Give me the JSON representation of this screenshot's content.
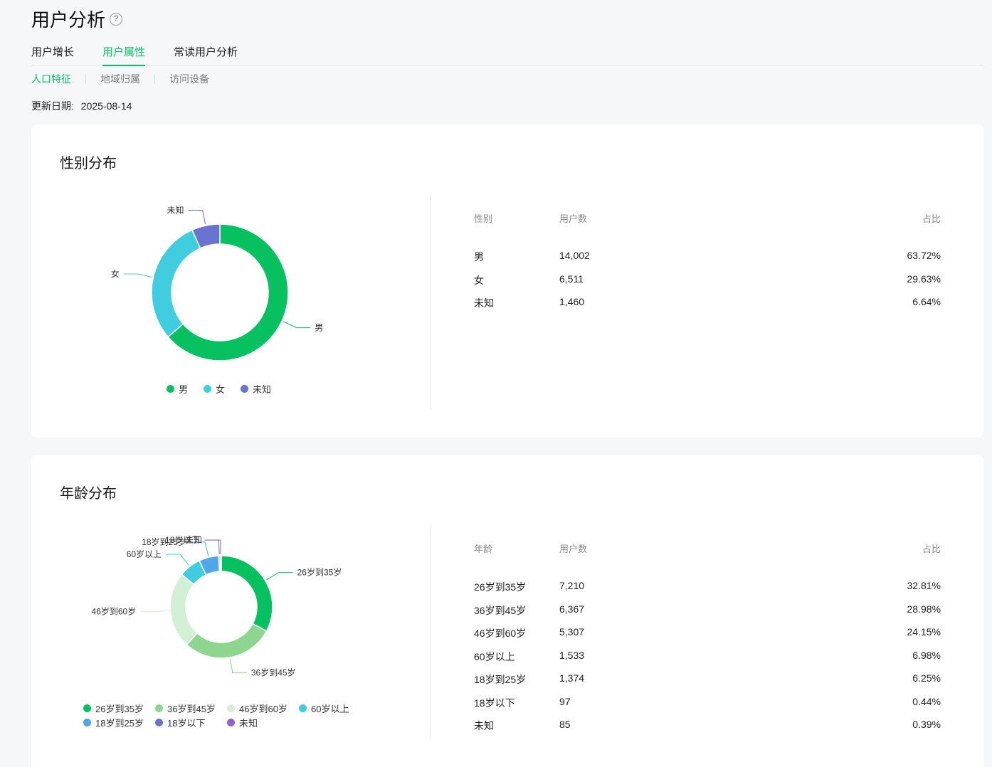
{
  "header": {
    "title": "用户分析",
    "help_icon": "question-circle-icon"
  },
  "tabs": [
    {
      "label": "用户增长"
    },
    {
      "label": "用户属性",
      "active": true
    },
    {
      "label": "常读用户分析"
    }
  ],
  "subtabs": [
    {
      "label": "人口特征",
      "active": true
    },
    {
      "label": "地域归属"
    },
    {
      "label": "访问设备"
    }
  ],
  "update": {
    "label": "更新日期:",
    "date": "2025-08-14"
  },
  "colors": {
    "accent": "#07c160"
  },
  "gender": {
    "title": "性别分布",
    "columns": {
      "name": "性别",
      "users": "用户数",
      "pct": "占比"
    },
    "rows": [
      {
        "name": "男",
        "users": "14,002",
        "pct": "63.72%",
        "color": "#07c160"
      },
      {
        "name": "女",
        "users": "6,511",
        "pct": "29.63%",
        "color": "#40cde0"
      },
      {
        "name": "未知",
        "users": "1,460",
        "pct": "6.64%",
        "color": "#6b73d1"
      }
    ]
  },
  "age": {
    "title": "年龄分布",
    "columns": {
      "name": "年龄",
      "users": "用户数",
      "pct": "占比"
    },
    "rows": [
      {
        "name": "26岁到35岁",
        "users": "7,210",
        "pct": "32.81%",
        "color": "#07c160"
      },
      {
        "name": "36岁到45岁",
        "users": "6,367",
        "pct": "28.98%",
        "color": "#8ed68f"
      },
      {
        "name": "46岁到60岁",
        "users": "5,307",
        "pct": "24.15%",
        "color": "#d2f0d5"
      },
      {
        "name": "60岁以上",
        "users": "1,533",
        "pct": "6.98%",
        "color": "#40cde0"
      },
      {
        "name": "18岁到25岁",
        "users": "1,374",
        "pct": "6.25%",
        "color": "#4fa7ea"
      },
      {
        "name": "18岁以下",
        "users": "97",
        "pct": "0.44%",
        "color": "#6b73d1"
      },
      {
        "name": "未知",
        "users": "85",
        "pct": "0.39%",
        "color": "#8f62d6"
      }
    ]
  },
  "chart_data": [
    {
      "type": "pie",
      "title": "性别分布",
      "categories": [
        "男",
        "女",
        "未知"
      ],
      "values": [
        14002,
        6511,
        1460
      ],
      "legend": "bottom"
    },
    {
      "type": "pie",
      "title": "年龄分布",
      "categories": [
        "26岁到35岁",
        "36岁到45岁",
        "46岁到60岁",
        "60岁以上",
        "18岁到25岁",
        "18岁以下",
        "未知"
      ],
      "values": [
        7210,
        6367,
        5307,
        1533,
        1374,
        97,
        85
      ],
      "legend": "bottom"
    }
  ]
}
